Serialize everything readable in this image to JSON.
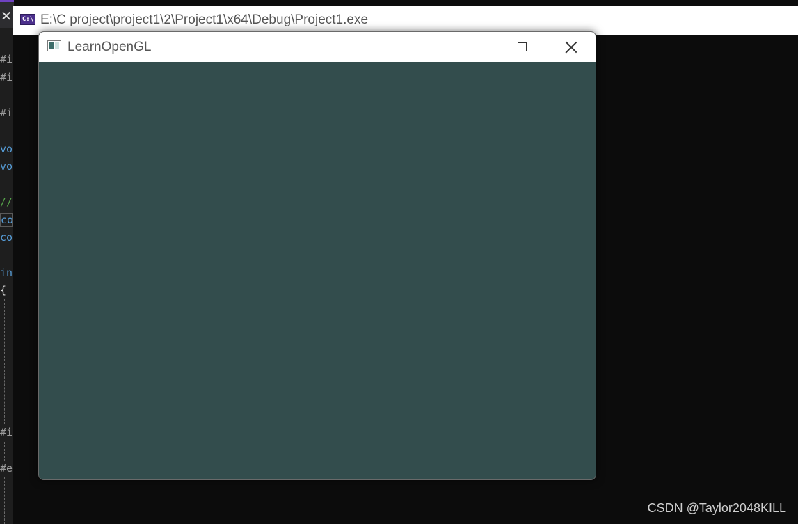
{
  "ide": {
    "close_glyph": "✕",
    "code_lines": [
      {
        "text": "#i",
        "kind": "directive"
      },
      {
        "text": "#i",
        "kind": "directive"
      },
      {
        "text": "#i",
        "kind": "directive"
      },
      {
        "text": "vo",
        "kind": "keyword"
      },
      {
        "text": "vo",
        "kind": "keyword"
      },
      {
        "text": "//",
        "kind": "comment"
      },
      {
        "text": "co",
        "kind": "keyword"
      },
      {
        "text": "co",
        "kind": "keyword"
      },
      {
        "text": "in",
        "kind": "keyword"
      },
      {
        "text": "{",
        "kind": "brace"
      },
      {
        "text": "#i",
        "kind": "directive"
      },
      {
        "text": "#e",
        "kind": "directive"
      }
    ]
  },
  "console": {
    "icon_text": "C:\\",
    "title": "E:\\C project\\project1\\2\\Project1\\x64\\Debug\\Project1.exe"
  },
  "glfw_window": {
    "title": "LearnOpenGL",
    "clear_color": "#334d4d",
    "controls": {
      "minimize": "minimize-icon",
      "maximize": "maximize-icon",
      "close": "close-icon"
    }
  },
  "watermark": "CSDN @Taylor2048KILL"
}
